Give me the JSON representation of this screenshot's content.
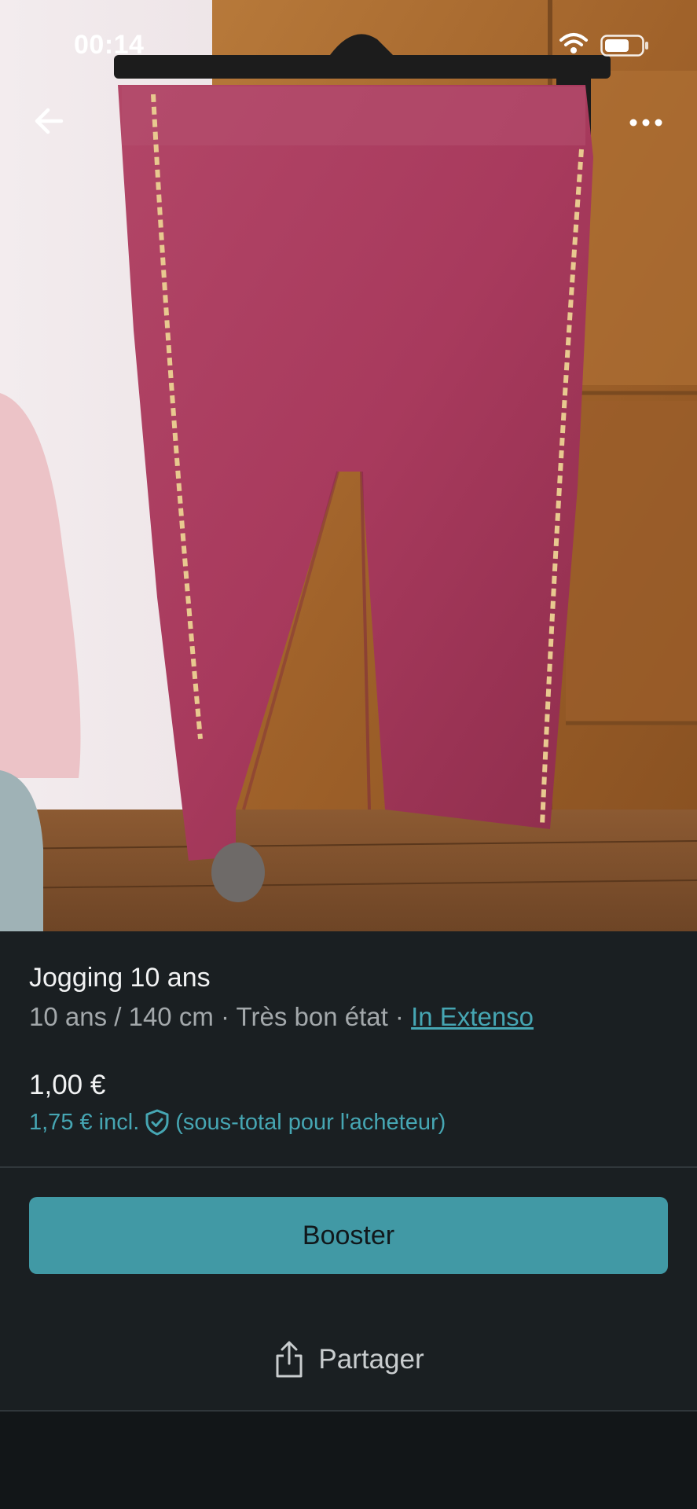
{
  "status_bar": {
    "time": "00:14"
  },
  "item": {
    "title": "Jogging 10 ans",
    "size": "10 ans / 140 cm",
    "sep1": " · ",
    "condition": "Très bon état",
    "sep2": " · ",
    "brand": "In Extenso",
    "price": "1,00 €",
    "price_incl": "1,75 € incl.",
    "price_note": "(sous-total pour l'acheteur)"
  },
  "actions": {
    "booster_label": "Booster",
    "share_label": "Partager"
  },
  "icons": {
    "back": "arrow-left-icon",
    "more": "more-horizontal-icon",
    "shield": "shield-check-icon",
    "share": "share-icon",
    "wifi": "wifi-icon",
    "battery": "battery-icon"
  },
  "colors": {
    "accent": "#4199a5",
    "link": "#46a6b3",
    "background": "#1a1f22"
  }
}
